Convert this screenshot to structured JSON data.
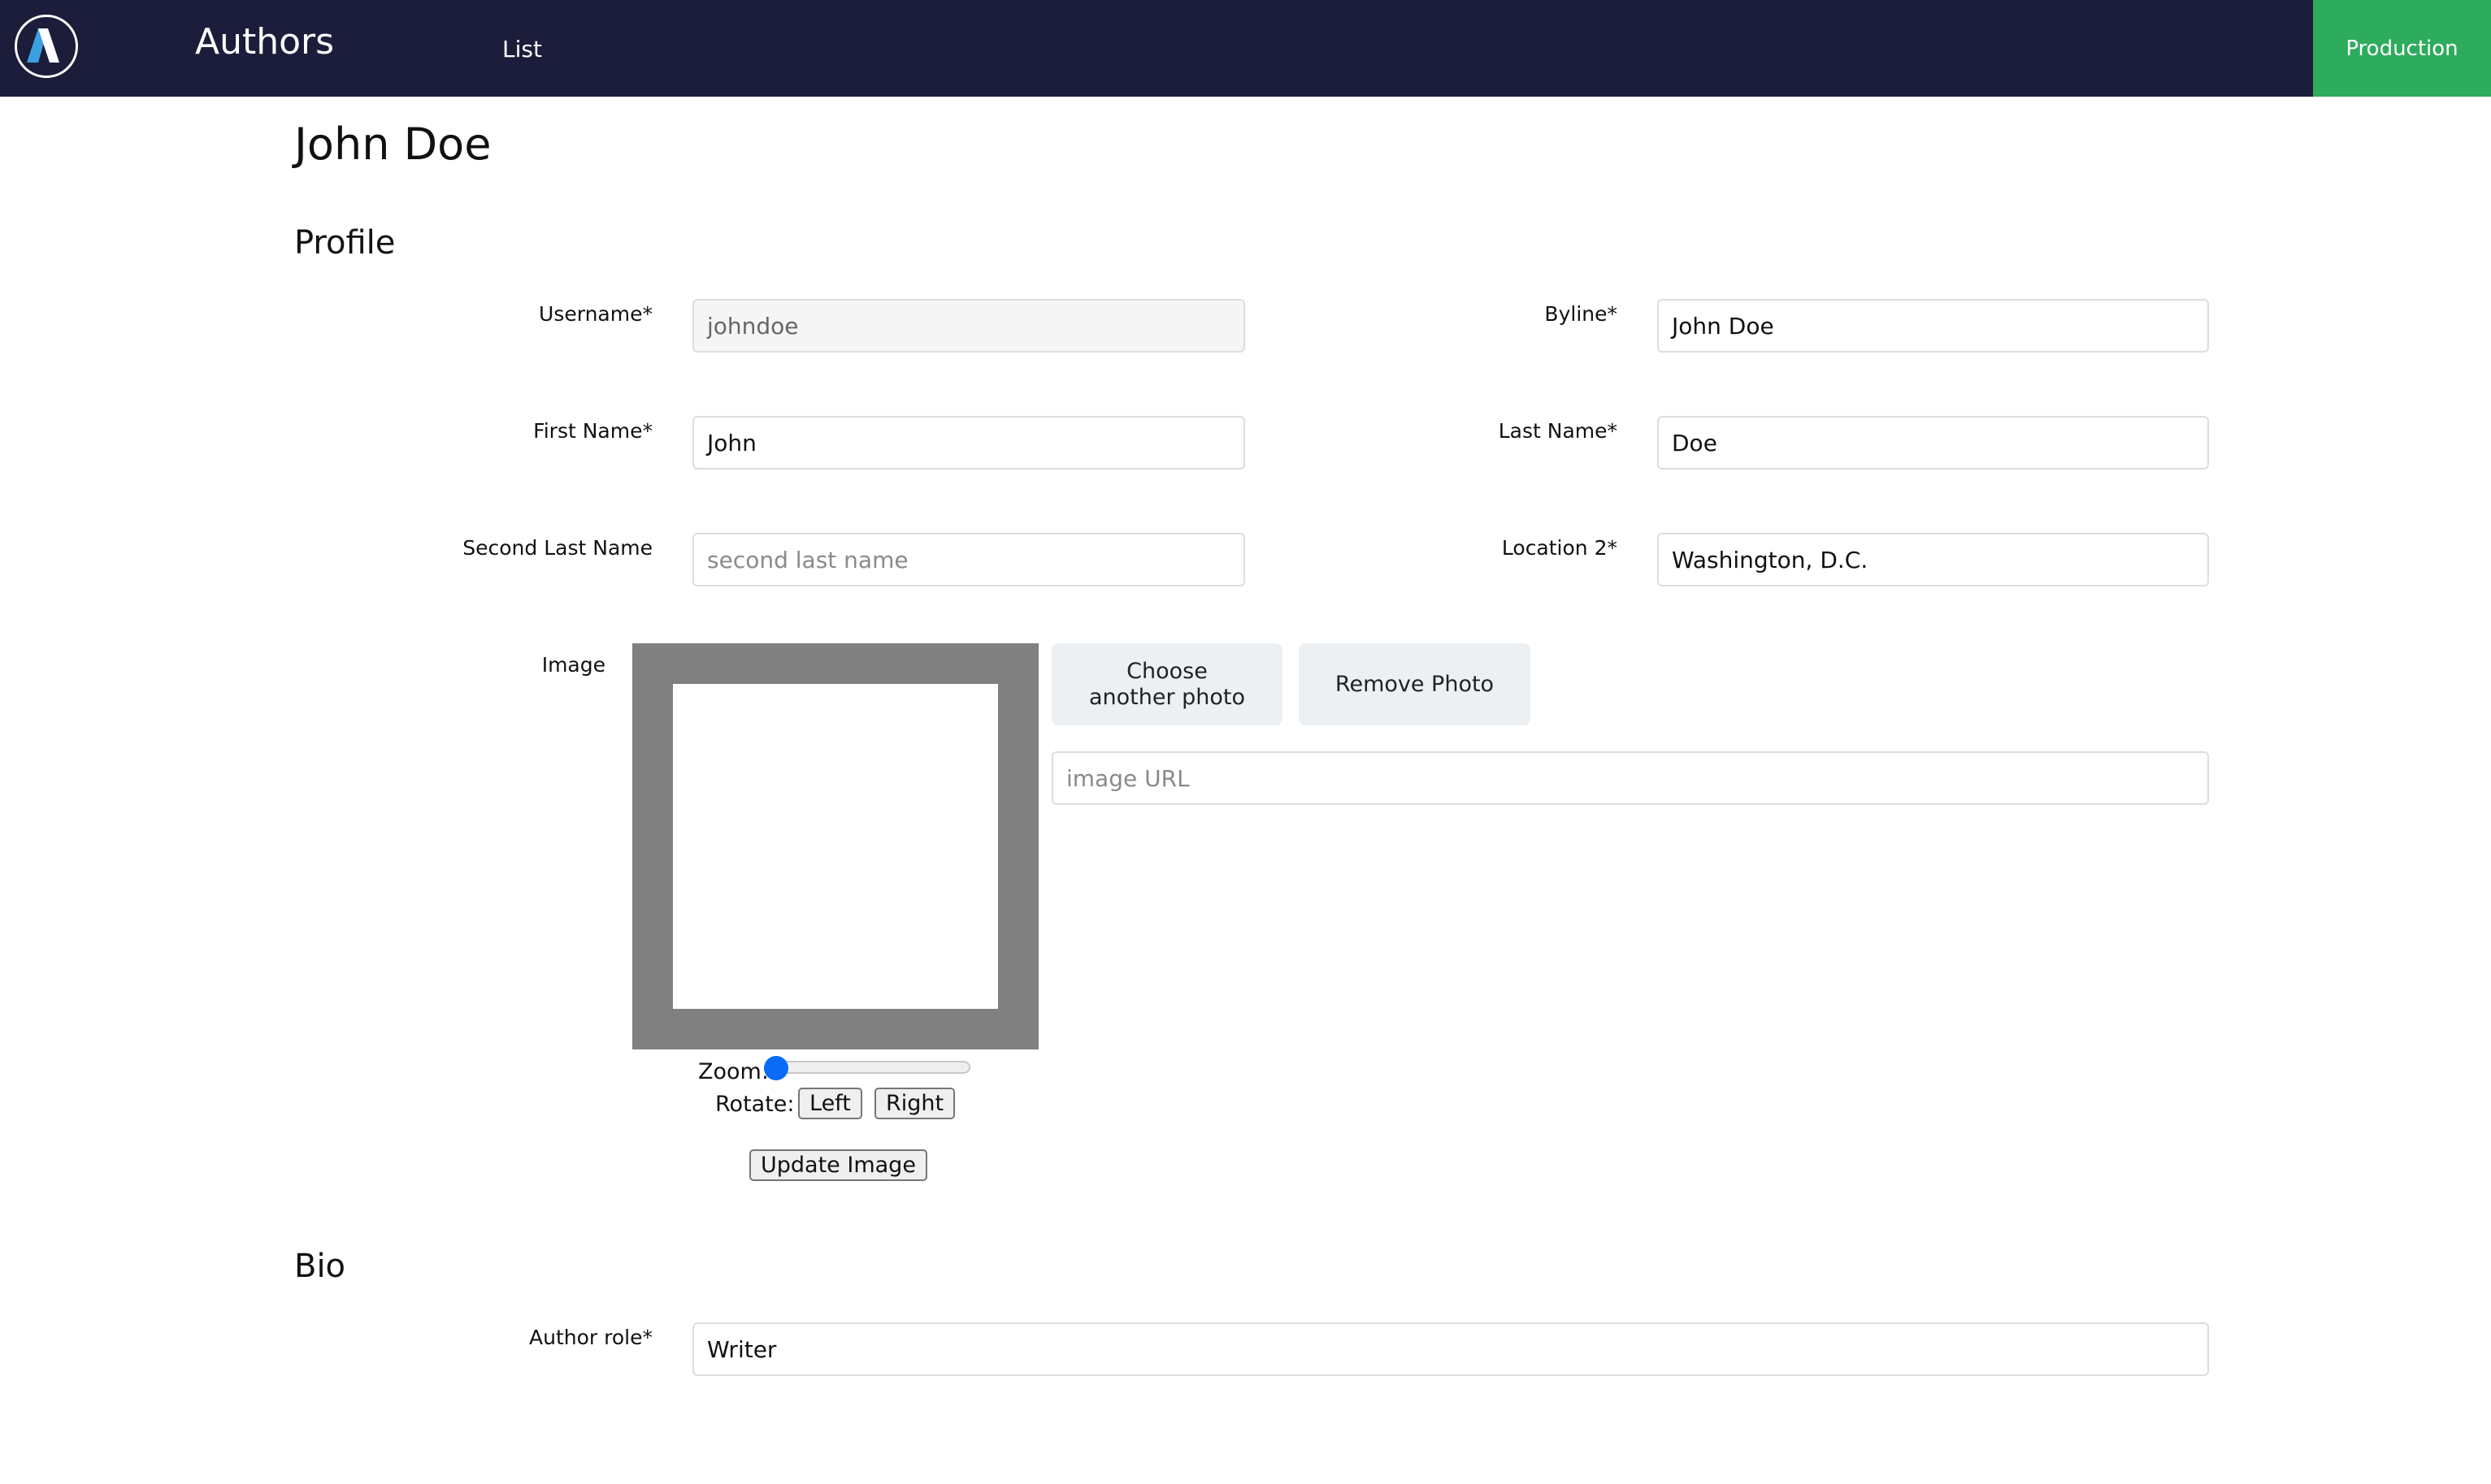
{
  "header": {
    "logo_icon": "app-logo-a-icon",
    "app_title": "Authors",
    "nav_list": "List",
    "environment": "Production",
    "colors": {
      "header_bg": "#1c1d3b",
      "environment_bg": "#2eac5d"
    }
  },
  "page": {
    "title": "John Doe"
  },
  "profile": {
    "heading": "Profile",
    "username": {
      "label": "Username*",
      "value": "johndoe",
      "disabled": true
    },
    "byline": {
      "label": "Byline*",
      "value": "John Doe"
    },
    "first_name": {
      "label": "First Name*",
      "value": "John"
    },
    "last_name": {
      "label": "Last Name*",
      "value": "Doe"
    },
    "second_last_name": {
      "label": "Second Last Name",
      "value": "",
      "placeholder": "second last name"
    },
    "location": {
      "label": "Location 2*",
      "value": "Washington, D.C."
    },
    "image": {
      "label": "Image",
      "choose_button_line1": "Choose",
      "choose_button_line2": "another photo",
      "remove_button": "Remove Photo",
      "url_placeholder": "image URL",
      "zoom_label": "Zoom:",
      "zoom_value": 0,
      "rotate_label": "Rotate:",
      "rotate_left": "Left",
      "rotate_right": "Right",
      "update_button": "Update Image"
    }
  },
  "bio": {
    "heading": "Bio",
    "author_role": {
      "label": "Author role*",
      "value": "Writer"
    }
  }
}
